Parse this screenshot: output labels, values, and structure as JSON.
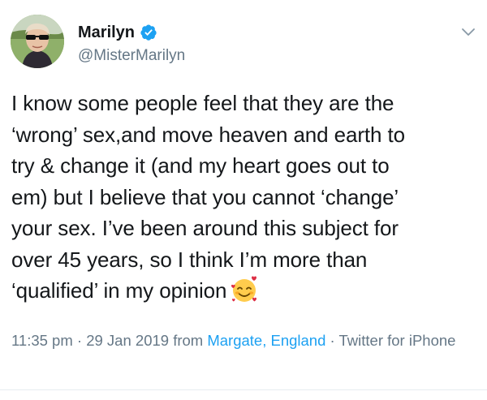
{
  "author": {
    "display_name": "Marilyn",
    "handle": "@MisterMarilyn",
    "verified": true,
    "avatar_icon": "avatar-photo"
  },
  "tweet": {
    "lines": [
      "I know some people feel that they are the",
      "‘wrong’ sex,and move heaven and earth to",
      "try & change it (and my heart goes out to",
      "em) but I believe that you cannot ‘change’",
      "your sex. I’ve been around this subject for",
      "over 45 years, so I think I’m more than",
      "‘qualified’ in my opinion"
    ],
    "emoji": "smiling-face-with-hearts"
  },
  "meta": {
    "time": "11:35 pm",
    "sep1": " · ",
    "date": "29 Jan 2019",
    "from": " from ",
    "location": "Margate, England",
    "sep2": " · ",
    "source": "Twitter for iPhone"
  },
  "colors": {
    "text": "#14171a",
    "secondary": "#657786",
    "link": "#1da1f2",
    "verified": "#1da1f2"
  }
}
